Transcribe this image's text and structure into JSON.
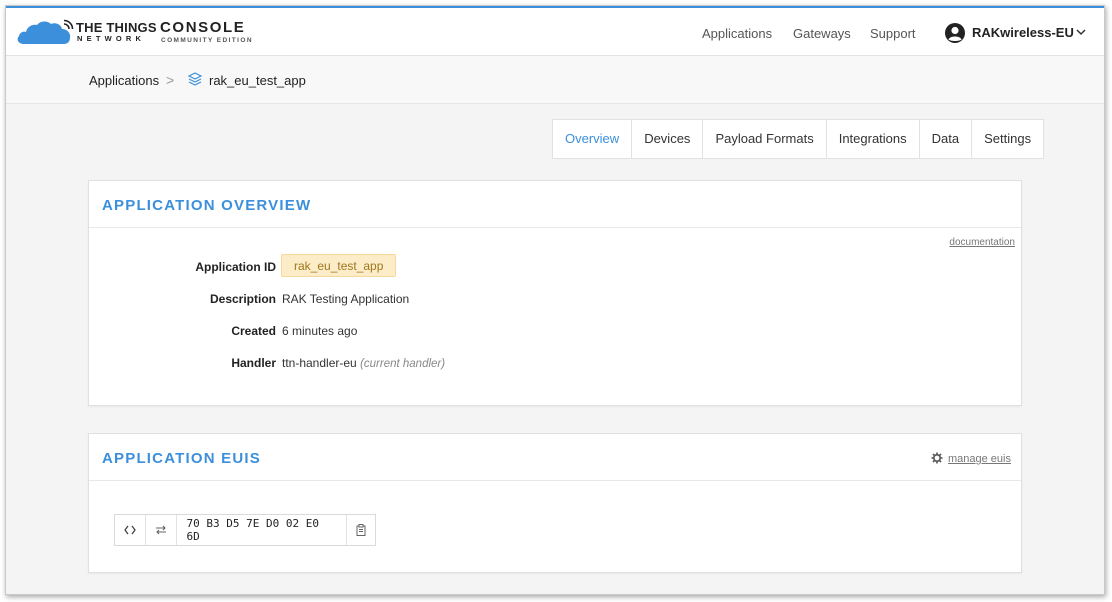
{
  "header": {
    "brand_name": "THE THINGS",
    "brand_sub": "NETWORK",
    "console_title": "CONSOLE",
    "console_sub": "COMMUNITY EDITION",
    "nav": [
      "Applications",
      "Gateways",
      "Support"
    ],
    "user_name": "RAKwireless-EU",
    "accent_color": "#3c8fdb"
  },
  "breadcrumb": {
    "root": "Applications",
    "separator": ">",
    "current": "rak_eu_test_app"
  },
  "tabs": [
    {
      "label": "Overview",
      "active": true
    },
    {
      "label": "Devices",
      "active": false
    },
    {
      "label": "Payload Formats",
      "active": false
    },
    {
      "label": "Integrations",
      "active": false
    },
    {
      "label": "Data",
      "active": false
    },
    {
      "label": "Settings",
      "active": false
    }
  ],
  "overview": {
    "title": "APPLICATION OVERVIEW",
    "doc_link": "documentation",
    "app_id_label": "Application ID",
    "app_id_value": "rak_eu_test_app",
    "description_label": "Description",
    "description_value": "RAK Testing Application",
    "created_label": "Created",
    "created_value": "6 minutes ago",
    "handler_label": "Handler",
    "handler_value": "ttn-handler-eu",
    "handler_note": "(current handler)"
  },
  "euis": {
    "title": "APPLICATION EUIS",
    "manage_label": "manage euis",
    "code_icon": "code-brackets-icon",
    "swap_icon": "swap-arrows-icon",
    "eui_value": "70 B3 D5 7E D0 02 E0 6D",
    "copy_icon": "clipboard-icon"
  }
}
